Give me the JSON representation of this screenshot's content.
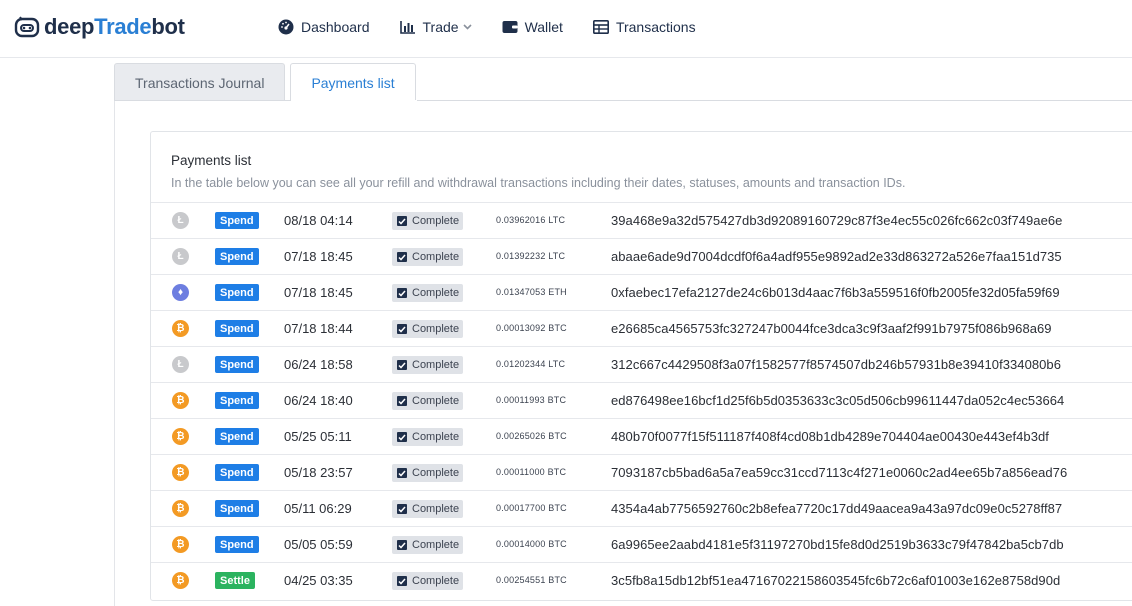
{
  "brand": {
    "part1": "deep",
    "part2": "Trade",
    "part3": "bot"
  },
  "nav": [
    {
      "label": "Dashboard",
      "icon": "dashboard-icon"
    },
    {
      "label": "Trade",
      "icon": "chart-icon",
      "has_dropdown": true
    },
    {
      "label": "Wallet",
      "icon": "wallet-icon"
    },
    {
      "label": "Transactions",
      "icon": "table-icon"
    }
  ],
  "tabs": [
    {
      "label": "Transactions Journal",
      "active": false
    },
    {
      "label": "Payments list",
      "active": true
    }
  ],
  "card": {
    "title": "Payments list",
    "subtitle": "In the table below you can see all your refill and withdrawal transactions including their dates, statuses, amounts and transaction IDs."
  },
  "colors": {
    "accent": "#2a7fd4",
    "spend": "#1e7ee6",
    "settle": "#2bb35f",
    "btc": "#f39a24",
    "eth": "#6d7ee0",
    "ltc": "#c8c9cc"
  },
  "rows": [
    {
      "coin": "ltc",
      "type": "Spend",
      "date": "08/18 04:14",
      "status": "Complete",
      "amount": "0.03962016 LTC",
      "txid": "39a468e9a32d575427db3d92089160729c87f3e4ec55c026fc662c03f749ae6e"
    },
    {
      "coin": "ltc",
      "type": "Spend",
      "date": "07/18 18:45",
      "status": "Complete",
      "amount": "0.01392232 LTC",
      "txid": "abaae6ade9d7004dcdf0f6a4adf955e9892ad2e33d863272a526e7faa151d735"
    },
    {
      "coin": "eth",
      "type": "Spend",
      "date": "07/18 18:45",
      "status": "Complete",
      "amount": "0.01347053 ETH",
      "txid": "0xfaebec17efa2127de24c6b013d4aac7f6b3a559516f0fb2005fe32d05fa59f69"
    },
    {
      "coin": "btc",
      "type": "Spend",
      "date": "07/18 18:44",
      "status": "Complete",
      "amount": "0.00013092 BTC",
      "txid": "e26685ca4565753fc327247b0044fce3dca3c9f3aaf2f991b7975f086b968a69"
    },
    {
      "coin": "ltc",
      "type": "Spend",
      "date": "06/24 18:58",
      "status": "Complete",
      "amount": "0.01202344 LTC",
      "txid": "312c667c4429508f3a07f1582577f8574507db246b57931b8e39410f334080b6"
    },
    {
      "coin": "btc",
      "type": "Spend",
      "date": "06/24 18:40",
      "status": "Complete",
      "amount": "0.00011993 BTC",
      "txid": "ed876498ee16bcf1d25f6b5d0353633c3c05d506cb99611447da052c4ec53664"
    },
    {
      "coin": "btc",
      "type": "Spend",
      "date": "05/25 05:11",
      "status": "Complete",
      "amount": "0.00265026 BTC",
      "txid": "480b70f0077f15f511187f408f4cd08b1db4289e704404ae00430e443ef4b3df"
    },
    {
      "coin": "btc",
      "type": "Spend",
      "date": "05/18 23:57",
      "status": "Complete",
      "amount": "0.00011000 BTC",
      "txid": "7093187cb5bad6a5a7ea59cc31ccd7113c4f271e0060c2ad4ee65b7a856ead76"
    },
    {
      "coin": "btc",
      "type": "Spend",
      "date": "05/11 06:29",
      "status": "Complete",
      "amount": "0.00017700 BTC",
      "txid": "4354a4ab7756592760c2b8efea7720c17dd49aacea9a43a97dc09e0c5278ff87"
    },
    {
      "coin": "btc",
      "type": "Spend",
      "date": "05/05 05:59",
      "status": "Complete",
      "amount": "0.00014000 BTC",
      "txid": "6a9965ee2aabd4181e5f31197270bd15fe8d0d2519b3633c79f47842ba5cb7db"
    },
    {
      "coin": "btc",
      "type": "Settle",
      "date": "04/25 03:35",
      "status": "Complete",
      "amount": "0.00254551 BTC",
      "txid": "3c5fb8a15db12bf51ea47167022158603545fc6b72c6af01003e162e8758d90d"
    }
  ]
}
